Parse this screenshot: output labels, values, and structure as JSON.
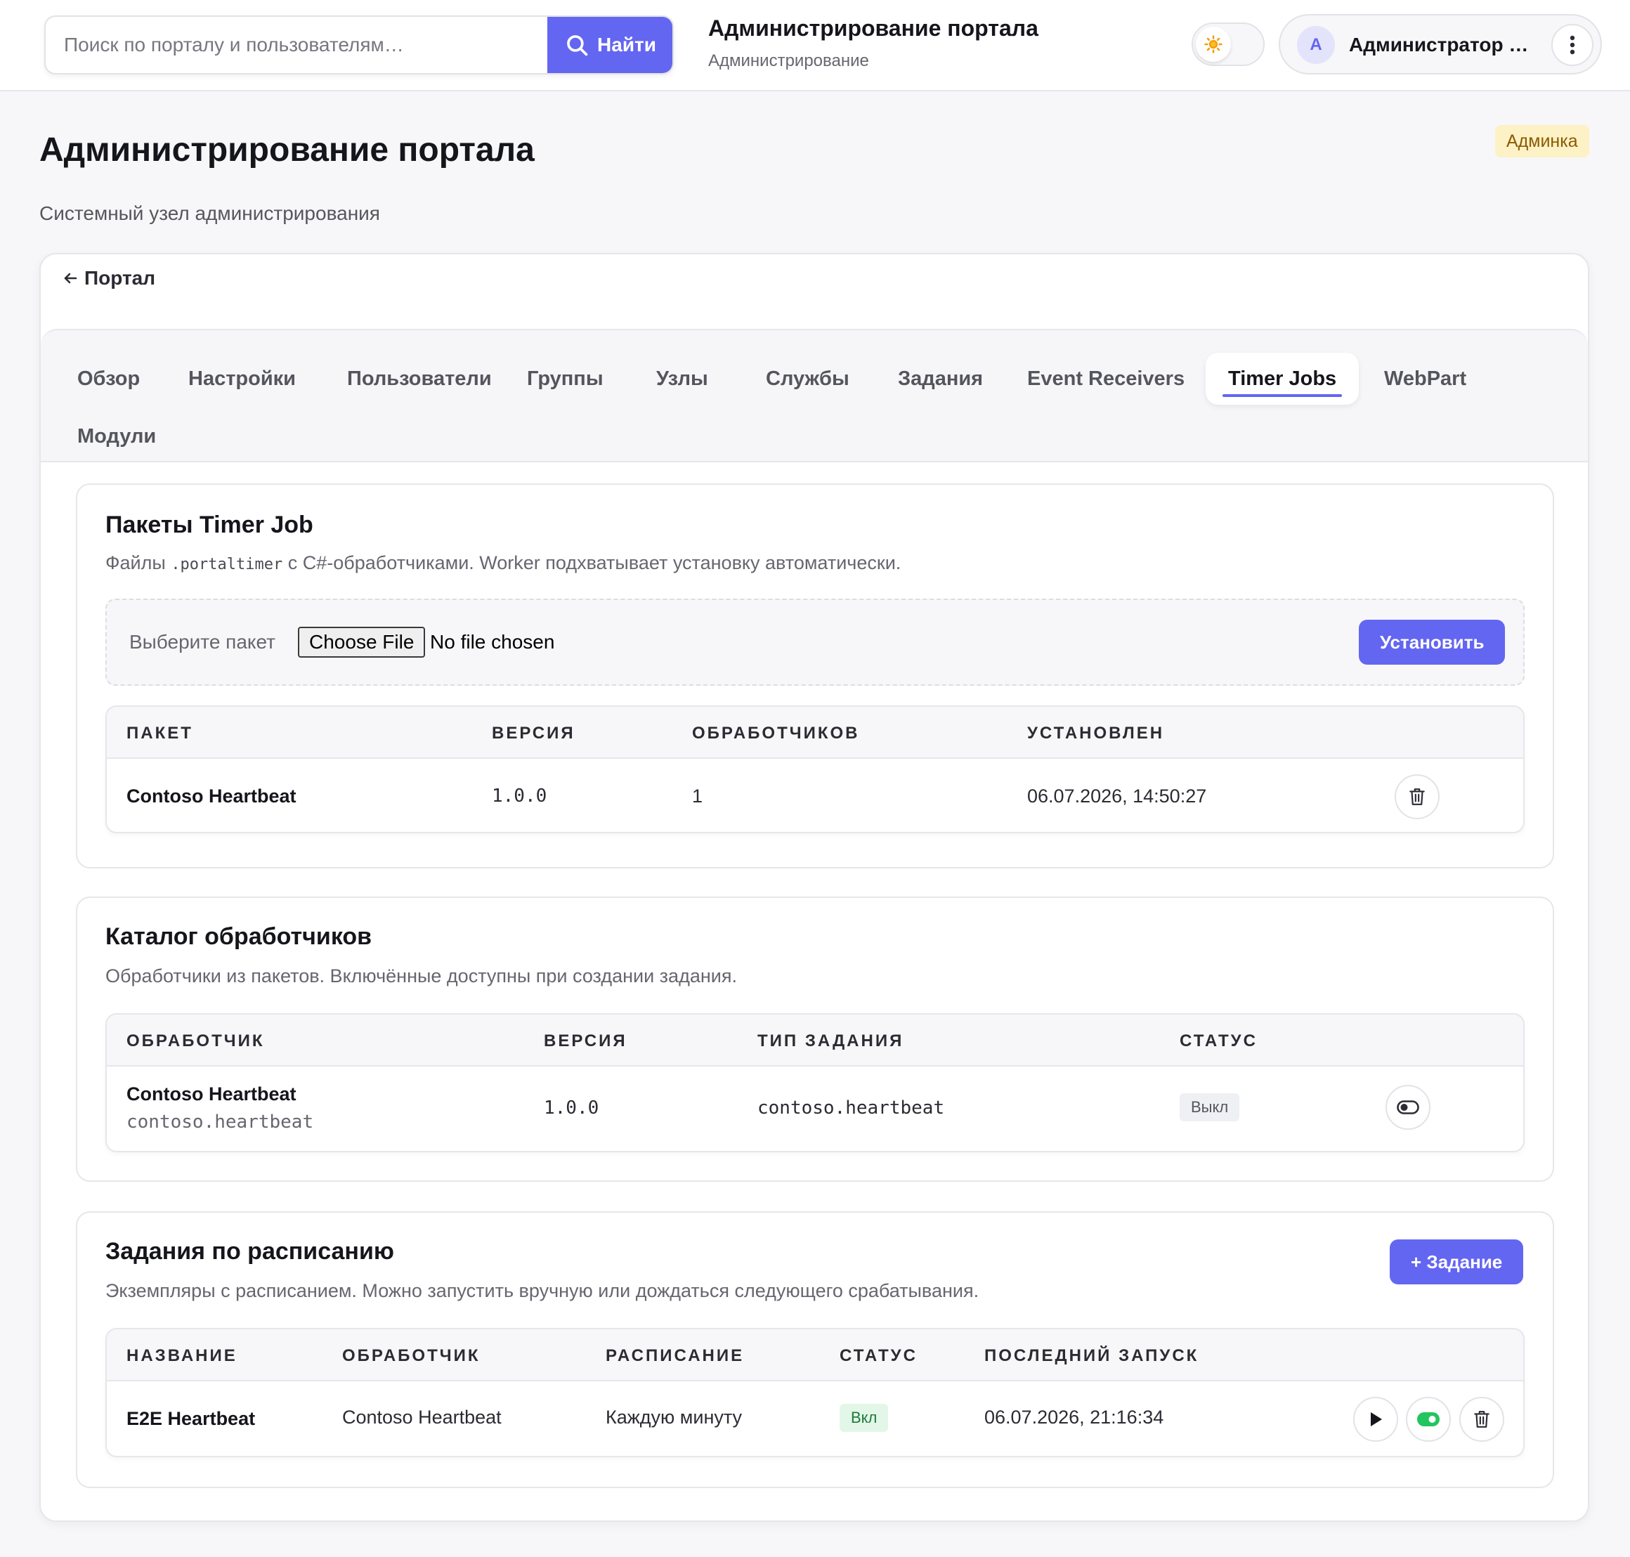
{
  "header": {
    "search_placeholder": "Поиск по порталу и пользователям…",
    "search_button": "Найти",
    "app_title": "Администрирование портала",
    "app_subtitle": "Администрирование",
    "avatar_letter": "A",
    "user_name": "Администратор портала"
  },
  "page": {
    "title": "Администрирование портала",
    "subtitle": "Системный узел администрирования",
    "badge": "Админка",
    "back_link": "Портал"
  },
  "tabs": [
    {
      "label": "Обзор"
    },
    {
      "label": "Настройки"
    },
    {
      "label": "Пользователи"
    },
    {
      "label": "Группы"
    },
    {
      "label": "Узлы"
    },
    {
      "label": "Службы"
    },
    {
      "label": "Задания"
    },
    {
      "label": "Event Receivers"
    },
    {
      "label": "Timer Jobs",
      "active": true
    },
    {
      "label": "WebPart"
    },
    {
      "label": "Модули"
    }
  ],
  "packages": {
    "title": "Пакеты Timer Job",
    "desc_prefix": "Файлы",
    "desc_code": ".portaltimer",
    "desc_suffix": "с C#-обработчиками. Worker подхватывает установку автоматически.",
    "upload_label": "Выберите пакет",
    "file_button": "Choose File",
    "file_status": "No file chosen",
    "install_button": "Установить",
    "columns": [
      "ПАКЕТ",
      "ВЕРСИЯ",
      "ОБРАБОТЧИКОВ",
      "УСТАНОВЛЕН"
    ],
    "rows": [
      {
        "name": "Contoso Heartbeat",
        "version": "1.0.0",
        "handlers": "1",
        "installed": "06.07.2026, 14:50:27"
      }
    ]
  },
  "catalog": {
    "title": "Каталог обработчиков",
    "desc": "Обработчики из пакетов. Включённые доступны при создании задания.",
    "columns": [
      "ОБРАБОТЧИК",
      "ВЕРСИЯ",
      "ТИП ЗАДАНИЯ",
      "СТАТУС"
    ],
    "rows": [
      {
        "name": "Contoso Heartbeat",
        "id": "contoso.heartbeat",
        "version": "1.0.0",
        "job_type": "contoso.heartbeat",
        "status": "Выкл"
      }
    ]
  },
  "jobs": {
    "title": "Задания по расписанию",
    "desc": "Экземпляры с расписанием. Можно запустить вручную или дождаться следующего срабатывания.",
    "add_button": "+ Задание",
    "columns": [
      "НАЗВАНИЕ",
      "ОБРАБОТЧИК",
      "РАСПИСАНИЕ",
      "СТАТУС",
      "ПОСЛЕДНИЙ ЗАПУСК"
    ],
    "rows": [
      {
        "name": "E2E Heartbeat",
        "handler": "Contoso Heartbeat",
        "schedule": "Каждую минуту",
        "status": "Вкл",
        "last_run": "06.07.2026, 21:16:34"
      }
    ]
  },
  "colors": {
    "accent": "#6366f1",
    "success": "#22c55e",
    "warning_bg": "#fdf1c6"
  },
  "icons": [
    "search-icon",
    "sun-icon",
    "more-vertical-icon",
    "arrow-left-icon",
    "trash-icon",
    "toggle-off-icon",
    "play-icon",
    "toggle-on-icon"
  ]
}
